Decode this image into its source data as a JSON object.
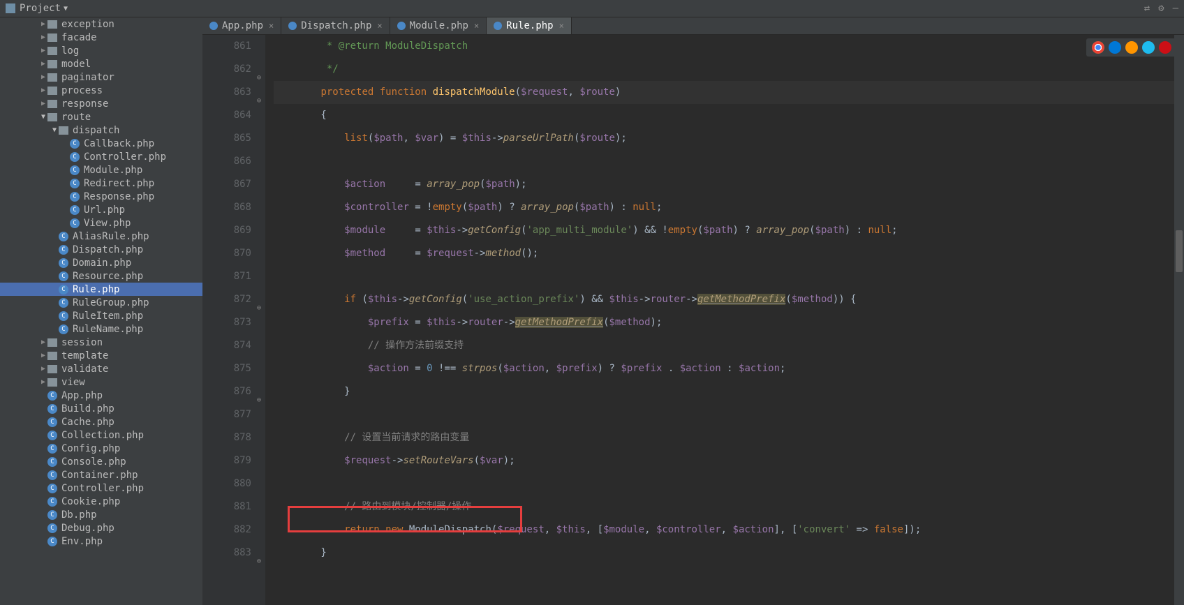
{
  "project_label": "Project",
  "tabs": [
    {
      "label": "App.php",
      "active": false
    },
    {
      "label": "Dispatch.php",
      "active": false
    },
    {
      "label": "Module.php",
      "active": false
    },
    {
      "label": "Rule.php",
      "active": true
    }
  ],
  "tree": [
    {
      "depth": 3,
      "type": "folder",
      "label": "exception",
      "arrow": "▶"
    },
    {
      "depth": 3,
      "type": "folder",
      "label": "facade",
      "arrow": "▶"
    },
    {
      "depth": 3,
      "type": "folder",
      "label": "log",
      "arrow": "▶"
    },
    {
      "depth": 3,
      "type": "folder",
      "label": "model",
      "arrow": "▶"
    },
    {
      "depth": 3,
      "type": "folder",
      "label": "paginator",
      "arrow": "▶"
    },
    {
      "depth": 3,
      "type": "folder",
      "label": "process",
      "arrow": "▶"
    },
    {
      "depth": 3,
      "type": "folder",
      "label": "response",
      "arrow": "▶"
    },
    {
      "depth": 3,
      "type": "folder",
      "label": "route",
      "arrow": "▼"
    },
    {
      "depth": 4,
      "type": "folder",
      "label": "dispatch",
      "arrow": "▼"
    },
    {
      "depth": 5,
      "type": "php",
      "label": "Callback.php"
    },
    {
      "depth": 5,
      "type": "php",
      "label": "Controller.php"
    },
    {
      "depth": 5,
      "type": "php",
      "label": "Module.php"
    },
    {
      "depth": 5,
      "type": "php",
      "label": "Redirect.php"
    },
    {
      "depth": 5,
      "type": "php",
      "label": "Response.php"
    },
    {
      "depth": 5,
      "type": "php",
      "label": "Url.php"
    },
    {
      "depth": 5,
      "type": "php",
      "label": "View.php"
    },
    {
      "depth": 4,
      "type": "php",
      "label": "AliasRule.php"
    },
    {
      "depth": 4,
      "type": "php",
      "label": "Dispatch.php"
    },
    {
      "depth": 4,
      "type": "php",
      "label": "Domain.php"
    },
    {
      "depth": 4,
      "type": "php",
      "label": "Resource.php"
    },
    {
      "depth": 4,
      "type": "php",
      "label": "Rule.php",
      "selected": true
    },
    {
      "depth": 4,
      "type": "php",
      "label": "RuleGroup.php"
    },
    {
      "depth": 4,
      "type": "php",
      "label": "RuleItem.php"
    },
    {
      "depth": 4,
      "type": "php",
      "label": "RuleName.php"
    },
    {
      "depth": 3,
      "type": "folder",
      "label": "session",
      "arrow": "▶"
    },
    {
      "depth": 3,
      "type": "folder",
      "label": "template",
      "arrow": "▶"
    },
    {
      "depth": 3,
      "type": "folder",
      "label": "validate",
      "arrow": "▶"
    },
    {
      "depth": 3,
      "type": "folder",
      "label": "view",
      "arrow": "▶"
    },
    {
      "depth": 3,
      "type": "php",
      "label": "App.php"
    },
    {
      "depth": 3,
      "type": "php",
      "label": "Build.php"
    },
    {
      "depth": 3,
      "type": "php",
      "label": "Cache.php"
    },
    {
      "depth": 3,
      "type": "php",
      "label": "Collection.php"
    },
    {
      "depth": 3,
      "type": "php",
      "label": "Config.php"
    },
    {
      "depth": 3,
      "type": "php",
      "label": "Console.php"
    },
    {
      "depth": 3,
      "type": "php",
      "label": "Container.php"
    },
    {
      "depth": 3,
      "type": "php",
      "label": "Controller.php"
    },
    {
      "depth": 3,
      "type": "php",
      "label": "Cookie.php"
    },
    {
      "depth": 3,
      "type": "php",
      "label": "Db.php"
    },
    {
      "depth": 3,
      "type": "php",
      "label": "Debug.php"
    },
    {
      "depth": 3,
      "type": "php",
      "label": "Env.php"
    }
  ],
  "line_start": 861,
  "line_end": 883,
  "fold_lines": [
    862,
    863,
    872,
    876,
    883
  ],
  "code": {
    "861": {
      "t": "doc",
      "text": "         * @return ModuleDispatch"
    },
    "862": {
      "t": "doc",
      "text": "         */"
    },
    "863": {
      "t": "sig"
    },
    "864": {
      "t": "plain",
      "text": "        {"
    },
    "865": {
      "t": "l865"
    },
    "866": {
      "t": "empty"
    },
    "867": {
      "t": "l867"
    },
    "868": {
      "t": "l868"
    },
    "869": {
      "t": "l869"
    },
    "870": {
      "t": "l870"
    },
    "871": {
      "t": "empty"
    },
    "872": {
      "t": "l872"
    },
    "873": {
      "t": "l873"
    },
    "874": {
      "t": "comment",
      "text": "                // 操作方法前缀支持"
    },
    "875": {
      "t": "l875"
    },
    "876": {
      "t": "plain",
      "text": "            }"
    },
    "877": {
      "t": "empty"
    },
    "878": {
      "t": "comment",
      "text": "            // 设置当前请求的路由变量"
    },
    "879": {
      "t": "l879"
    },
    "880": {
      "t": "empty"
    },
    "881": {
      "t": "comment",
      "text": "            // 路由到模块/控制器/操作"
    },
    "882": {
      "t": "l882"
    },
    "883": {
      "t": "plain",
      "text": "        }"
    }
  }
}
